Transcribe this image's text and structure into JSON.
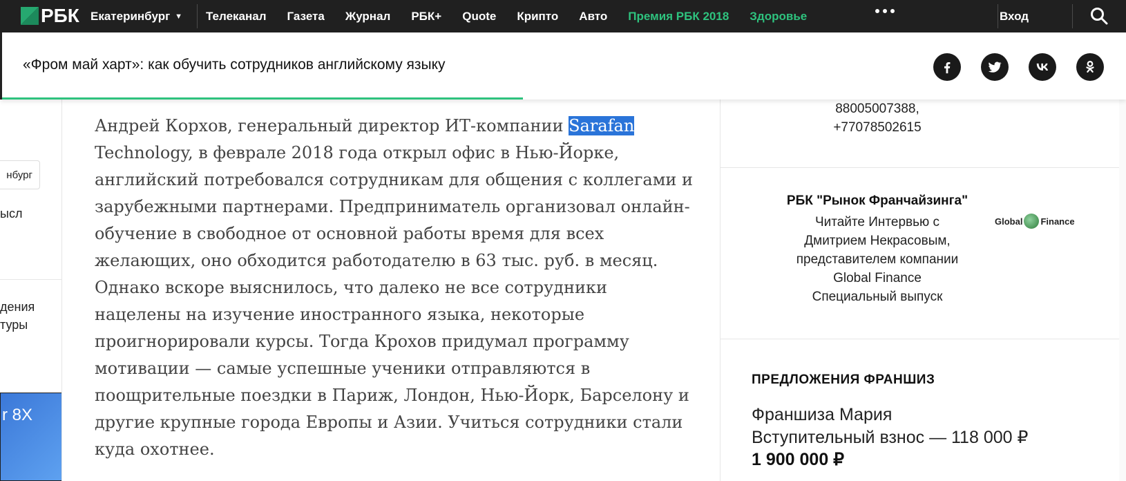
{
  "nav": {
    "logo": "РБК",
    "city": "Екатеринбург",
    "items": [
      {
        "label": "Телеканал",
        "accent": false
      },
      {
        "label": "Газета",
        "accent": false
      },
      {
        "label": "Журнал",
        "accent": false
      },
      {
        "label": "РБК+",
        "accent": false
      },
      {
        "label": "Quote",
        "accent": false
      },
      {
        "label": "Крипто",
        "accent": false
      },
      {
        "label": "Авто",
        "accent": false
      },
      {
        "label": "Премия РБК 2018",
        "accent": true
      },
      {
        "label": "Здоровье",
        "accent": true
      }
    ],
    "login": "Вход",
    "accent_color": "#2ec27e"
  },
  "sticky": {
    "title": "«Фром май харт»: как обучить сотрудников английскому языку",
    "share_icons": [
      "facebook-icon",
      "twitter-icon",
      "vk-icon",
      "odnoklassniki-icon"
    ]
  },
  "left": {
    "chip": "нбург",
    "lines": [
      "ысл",
      "дения",
      "туры"
    ],
    "ad_text": "r 8X"
  },
  "article": {
    "before_highlight": "Андрей Корхов, генеральный директор ИТ-компании ",
    "highlight": "Sarafan",
    "after_highlight": " Technology, в феврале 2018 года открыл офис в Нью-Йорке, английский потребовался сотрудникам для общения с коллегами и зарубежными партнерами. Предприниматель организовал онлайн-обучение в свободное от основной работы время для всех желающих, оно обходится работодателю в 63 тыс. руб. в месяц. Однако вскоре выяснилось, что далеко не все сотрудники нацелены на изучение иностранного языка, некоторые проигнорировали курсы. Тогда Крохов придумал программу мотивации — самые успешные ученики отправляются в поощрительные поездки в Париж, Лондон, Нью-Йорк, Барселону и другие крупные города Европы и Азии. Учиться сотрудники стали куда охотнее."
  },
  "sidebar": {
    "phones": [
      "88005007388,",
      "+77078502615"
    ],
    "promo": {
      "title": "РБК \"Рынок Франчайзинга\"",
      "lines": [
        "Читайте Интервью с",
        "Дмитрием Некрасовым,",
        "представителем компании",
        "Global Finance",
        "Специальный выпуск"
      ],
      "logo_left": "Global",
      "logo_right": "Finance"
    },
    "franchise": {
      "heading": "ПРЕДЛОЖЕНИЯ ФРАНШИЗ",
      "name": "Франшиза Мария",
      "fee": "Вступительный взнос — 118 000 ₽",
      "price": "1 900 000 ₽"
    }
  }
}
